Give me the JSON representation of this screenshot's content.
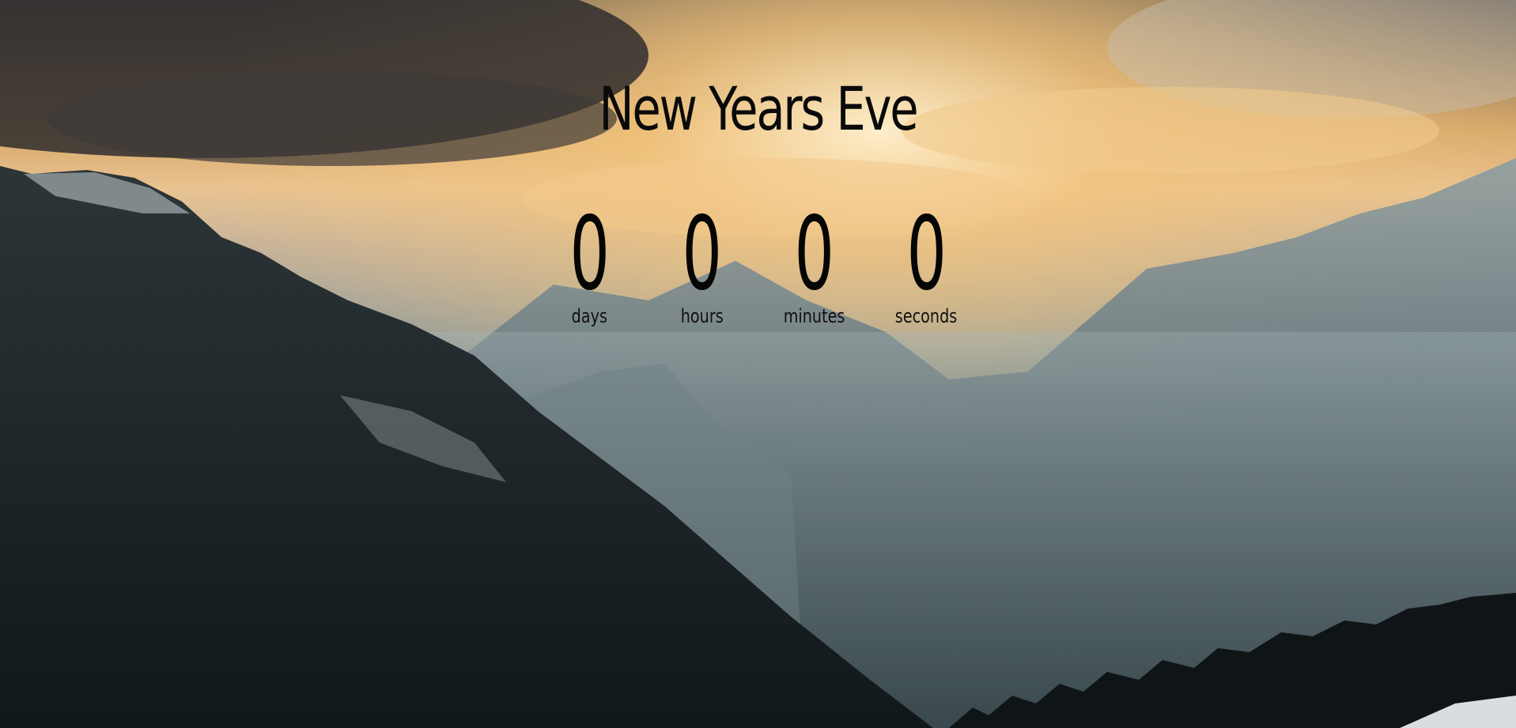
{
  "page": {
    "title": "New Years Eve"
  },
  "countdown": {
    "days": {
      "value": "0",
      "label": "days"
    },
    "hours": {
      "value": "0",
      "label": "hours"
    },
    "minutes": {
      "value": "0",
      "label": "minutes"
    },
    "seconds": {
      "value": "0",
      "label": "seconds"
    }
  },
  "background": {
    "description_icon": "mountain-landscape-image",
    "colors": {
      "sky_warm": "#e9c391",
      "sky_dark": "#3d3a38",
      "mountain_dark": "#1a2224",
      "mountain_mid": "#5d6e72",
      "haze": "#9fb0b2"
    }
  }
}
